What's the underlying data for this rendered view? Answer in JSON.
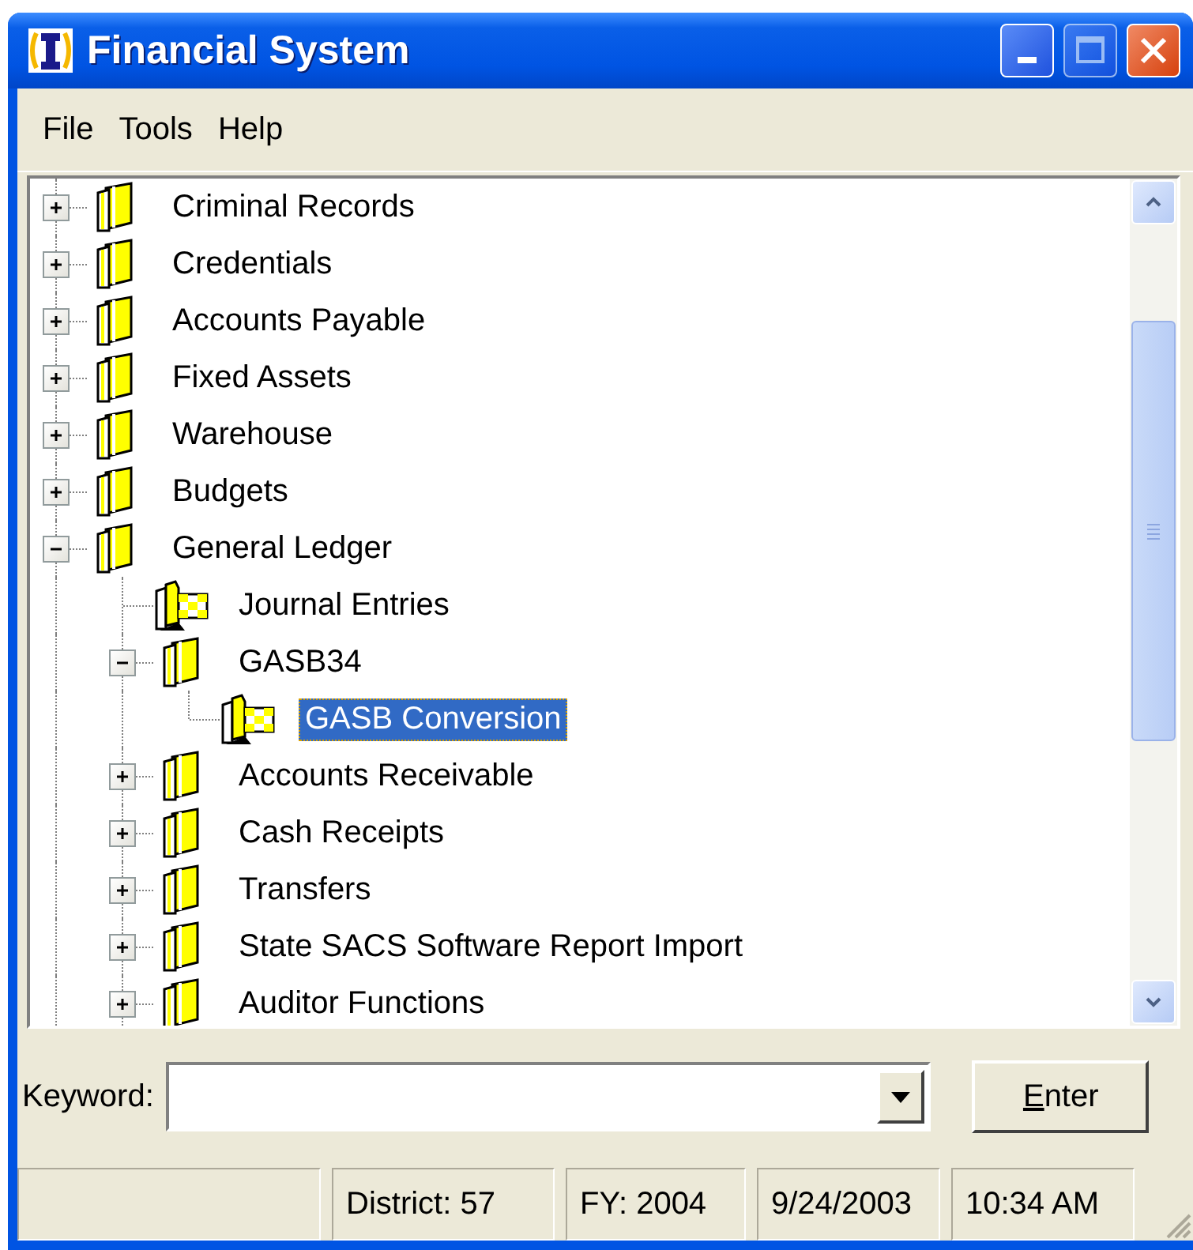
{
  "window": {
    "title": "Financial System"
  },
  "menu": [
    "File",
    "Tools",
    "Help"
  ],
  "tree": [
    {
      "label": "Criminal Records",
      "kind": "folder",
      "expanded": false,
      "selected": false
    },
    {
      "label": "Credentials",
      "kind": "folder",
      "expanded": false,
      "selected": false
    },
    {
      "label": "Accounts Payable",
      "kind": "folder",
      "expanded": false,
      "selected": false
    },
    {
      "label": "Fixed Assets",
      "kind": "folder",
      "expanded": false,
      "selected": false
    },
    {
      "label": "Warehouse",
      "kind": "folder",
      "expanded": false,
      "selected": false
    },
    {
      "label": "Budgets",
      "kind": "folder",
      "expanded": false,
      "selected": false
    },
    {
      "label": "General Ledger",
      "kind": "folder",
      "expanded": true,
      "selected": false,
      "children": [
        {
          "label": "Journal Entries",
          "kind": "form",
          "selected": false
        },
        {
          "label": "GASB34",
          "kind": "folder",
          "expanded": true,
          "selected": false,
          "children": [
            {
              "label": "GASB Conversion",
              "kind": "form",
              "selected": true
            }
          ]
        },
        {
          "label": "Accounts Receivable",
          "kind": "folder",
          "expanded": false,
          "selected": false
        },
        {
          "label": "Cash Receipts",
          "kind": "folder",
          "expanded": false,
          "selected": false
        },
        {
          "label": "Transfers",
          "kind": "folder",
          "expanded": false,
          "selected": false
        },
        {
          "label": "State SACS Software Report Import",
          "kind": "folder",
          "expanded": false,
          "selected": false
        },
        {
          "label": "Auditor Functions",
          "kind": "folder",
          "expanded": false,
          "selected": false
        }
      ]
    }
  ],
  "keyword": {
    "label": "Keyword:"
  },
  "enter_button": "Enter",
  "status_bar": [
    "District: 57",
    "FY: 2004",
    "9/24/2003",
    "10:34 AM"
  ]
}
